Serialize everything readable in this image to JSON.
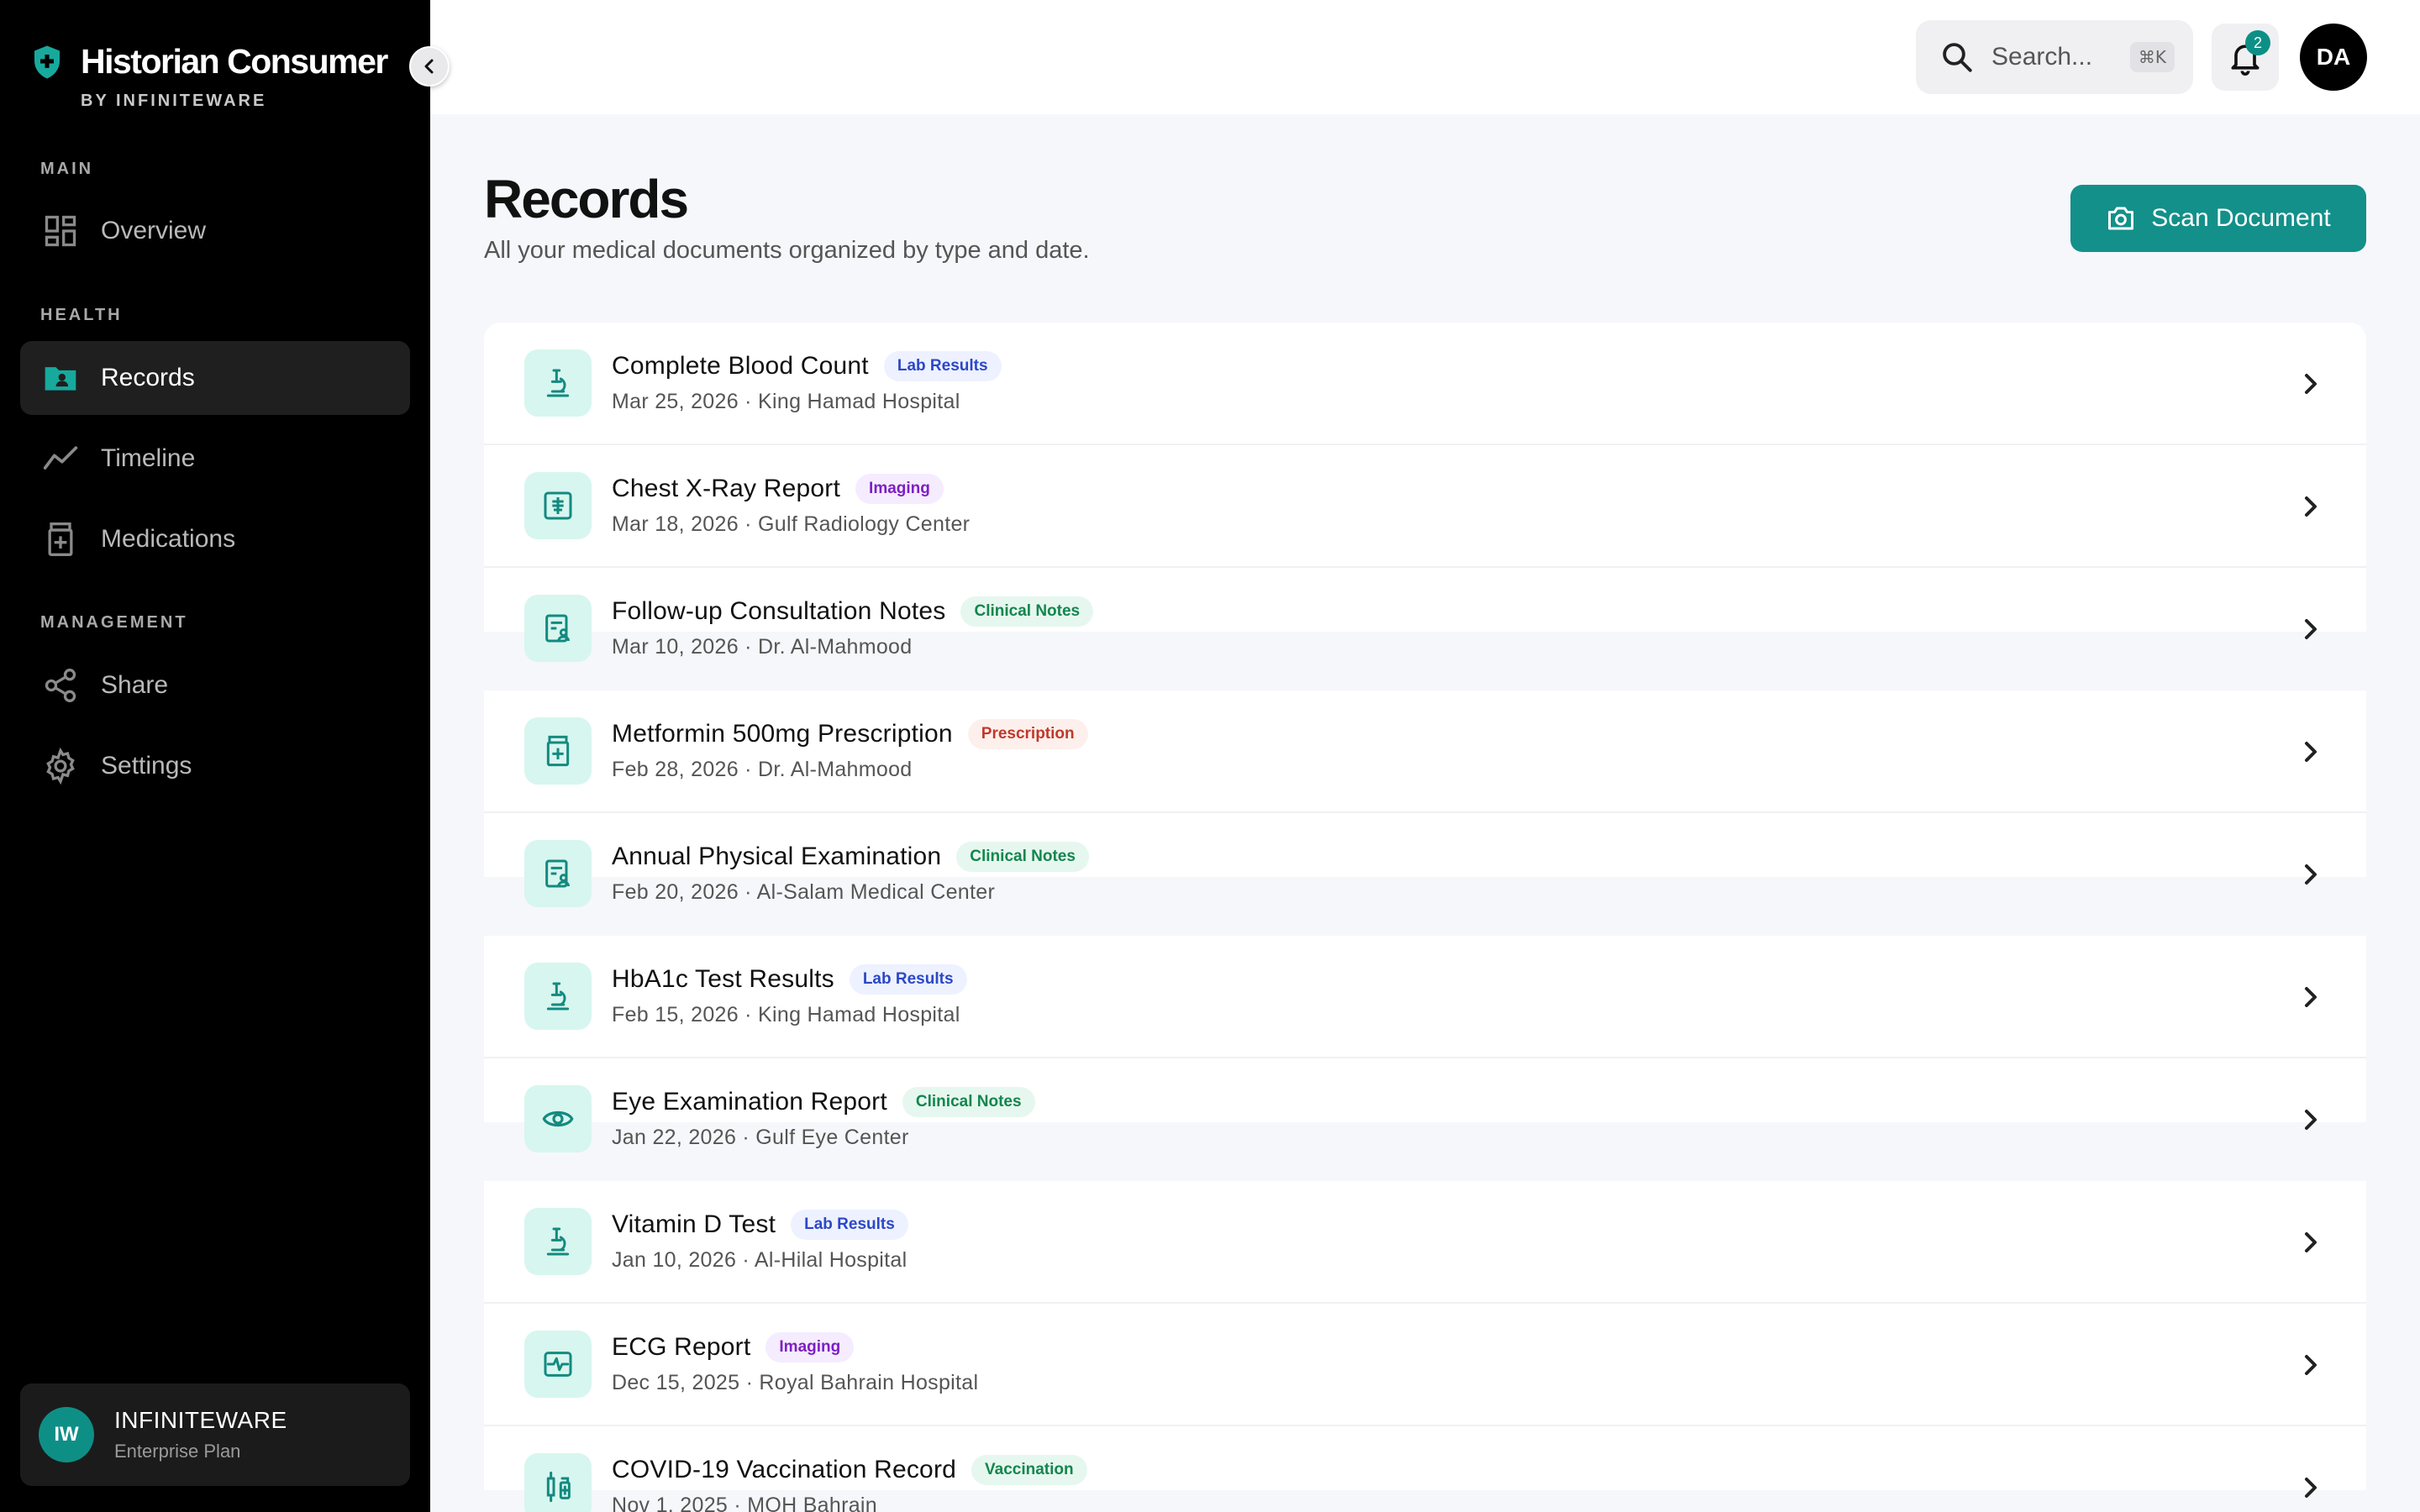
{
  "brand": {
    "title": "Historian Consumer",
    "subtitle": "BY INFINITEWARE"
  },
  "sidebar": {
    "sections": [
      {
        "label": "MAIN"
      },
      {
        "label": "HEALTH"
      },
      {
        "label": "MANAGEMENT"
      }
    ],
    "items": [
      {
        "label": "Overview",
        "icon": "grid-icon"
      },
      {
        "label": "Records",
        "icon": "folder-user-icon",
        "active": true
      },
      {
        "label": "Timeline",
        "icon": "trend-icon"
      },
      {
        "label": "Medications",
        "icon": "pill-bottle-icon"
      },
      {
        "label": "Share",
        "icon": "share-icon"
      },
      {
        "label": "Settings",
        "icon": "gear-icon"
      }
    ],
    "org": {
      "initials": "IW",
      "name": "INFINITEWARE",
      "plan": "Enterprise Plan"
    }
  },
  "topbar": {
    "search_placeholder": "Search...",
    "search_shortcut": "⌘K",
    "notification_count": "2",
    "user_initials": "DA"
  },
  "page": {
    "title": "Records",
    "subtitle": "All your medical documents organized by type and date.",
    "scan_button": "Scan Document"
  },
  "records": [
    {
      "title": "Complete Blood Count",
      "tag": "Lab Results",
      "meta": "Mar 25, 2026 · King Hamad Hospital",
      "icon": "microscope-icon"
    },
    {
      "title": "Chest X-Ray Report",
      "tag": "Imaging",
      "meta": "Mar 18, 2026 · Gulf Radiology Center",
      "icon": "xray-icon"
    },
    {
      "title": "Follow-up Consultation Notes",
      "tag": "Clinical Notes",
      "meta": "Mar 10, 2026 · Dr. Al-Mahmood",
      "icon": "clipboard-user-icon"
    },
    {
      "title": "Metformin 500mg Prescription",
      "tag": "Prescription",
      "meta": "Feb 28, 2026 · Dr. Al-Mahmood",
      "icon": "pill-bottle-icon"
    },
    {
      "title": "Annual Physical Examination",
      "tag": "Clinical Notes",
      "meta": "Feb 20, 2026 · Al-Salam Medical Center",
      "icon": "clipboard-user-icon"
    },
    {
      "title": "HbA1c Test Results",
      "tag": "Lab Results",
      "meta": "Feb 15, 2026 · King Hamad Hospital",
      "icon": "microscope-icon"
    },
    {
      "title": "Eye Examination Report",
      "tag": "Clinical Notes",
      "meta": "Jan 22, 2026 · Gulf Eye Center",
      "icon": "eye-icon"
    },
    {
      "title": "Vitamin D Test",
      "tag": "Lab Results",
      "meta": "Jan 10, 2026 · Al-Hilal Hospital",
      "icon": "microscope-icon"
    },
    {
      "title": "ECG Report",
      "tag": "Imaging",
      "meta": "Dec 15, 2025 · Royal Bahrain Hospital",
      "icon": "ecg-icon"
    },
    {
      "title": "COVID-19 Vaccination Record",
      "tag": "Vaccination",
      "meta": "Nov 1, 2025 · MOH Bahrain",
      "icon": "syringe-icon"
    }
  ],
  "colors": {
    "accent": "#13908a",
    "sidebar_bg": "#000000",
    "icon_tile": "#d7f6ef"
  }
}
